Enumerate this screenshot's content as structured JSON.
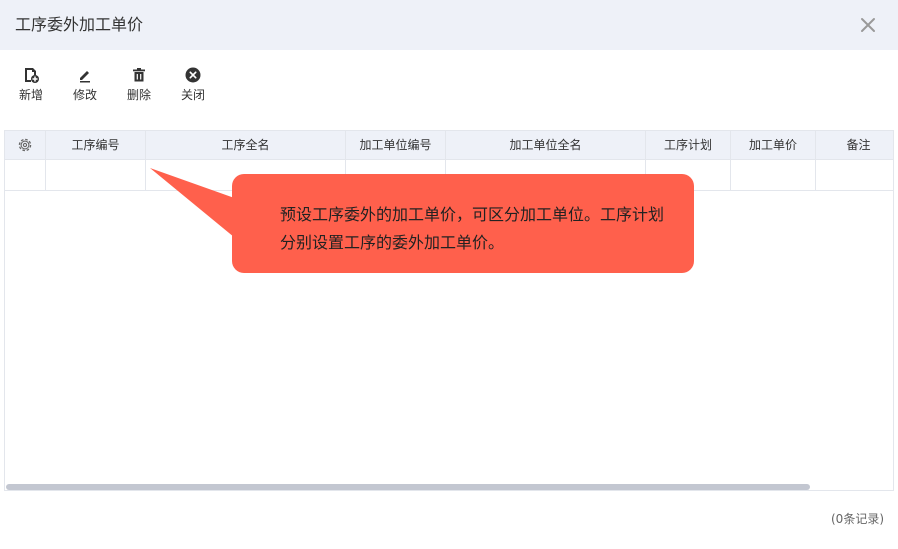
{
  "window": {
    "title": "工序委外加工单价"
  },
  "toolbar": {
    "add_label": "新增",
    "edit_label": "修改",
    "delete_label": "删除",
    "close_label": "关闭"
  },
  "table": {
    "columns": [
      "工序编号",
      "工序全名",
      "加工单位编号",
      "加工单位全名",
      "工序计划",
      "加工单价",
      "备注"
    ]
  },
  "callout": {
    "text": "预设工序委外的加工单价，可区分加工单位。工序计划分别设置工序的委外加工单价。"
  },
  "footer": {
    "record_count": "(0条记录)"
  },
  "colors": {
    "titlebar": "#eef1f8",
    "callout": "#ff604c",
    "scrollbar": "#c3c7d1"
  }
}
